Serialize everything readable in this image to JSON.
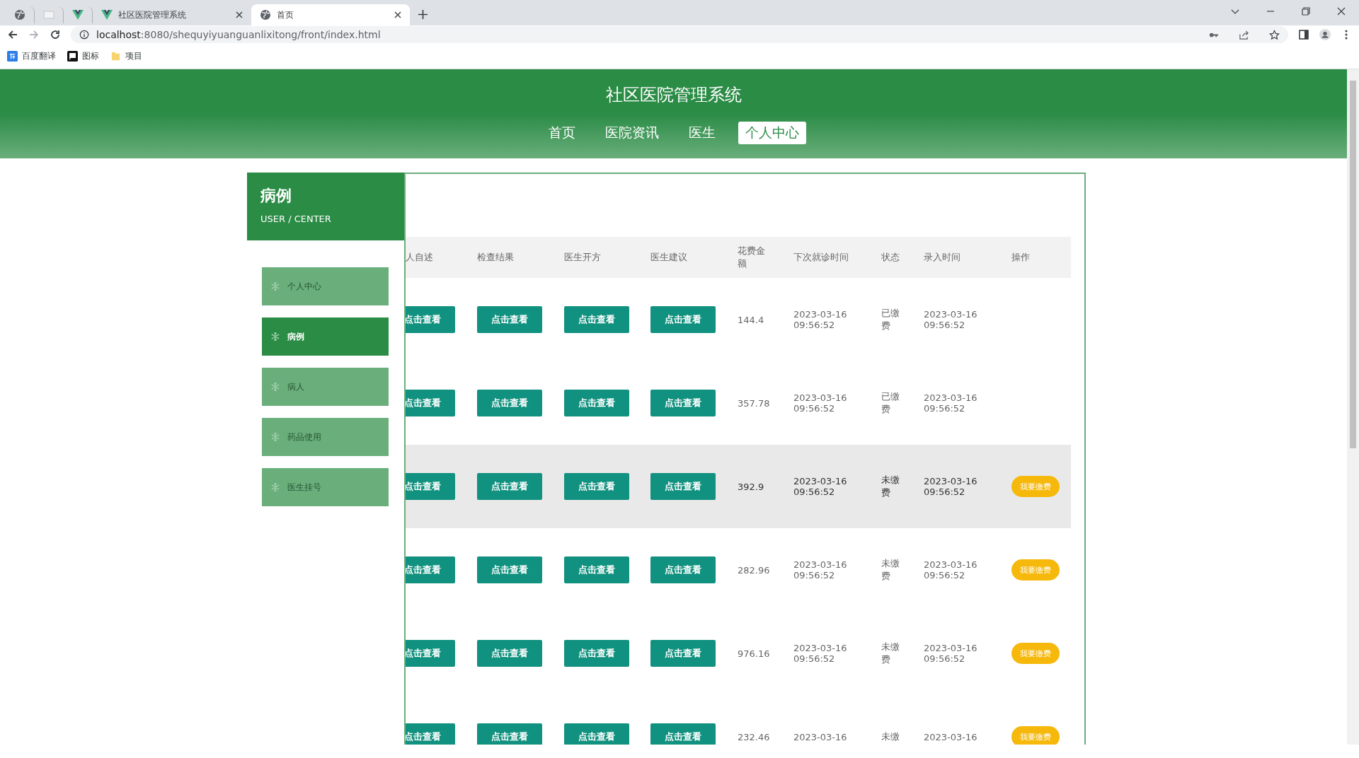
{
  "browser": {
    "tabs": [
      {
        "kind": "globe",
        "selected": false
      },
      {
        "kind": "blank",
        "selected": false
      },
      {
        "kind": "vue",
        "selected": false
      },
      {
        "kind": "vue",
        "title": "社区医院管理系统",
        "selected": false
      },
      {
        "kind": "globe",
        "title": "首页",
        "selected": true
      }
    ],
    "url_host": "localhost",
    "url_rest": ":8080/shequyiyuanguanlixitong/front/index.html",
    "bookmarks": [
      {
        "kind": "translate",
        "label": "百度翻译"
      },
      {
        "kind": "flag",
        "label": "图标"
      },
      {
        "kind": "folder",
        "label": "项目"
      }
    ]
  },
  "site": {
    "title": "社区医院管理系统",
    "nav": [
      {
        "label": "首页",
        "selected": false
      },
      {
        "label": "医院资讯",
        "selected": false
      },
      {
        "label": "医生",
        "selected": false
      },
      {
        "label": "个人中心",
        "selected": true
      }
    ]
  },
  "sidebar": {
    "title": "病例",
    "subtitle": "USER / CENTER",
    "items": [
      {
        "label": "个人中心",
        "selected": false
      },
      {
        "label": "病例",
        "selected": true
      },
      {
        "label": "病人",
        "selected": false
      },
      {
        "label": "药品使用",
        "selected": false
      },
      {
        "label": "医生挂号",
        "selected": false
      }
    ]
  },
  "table": {
    "columns": [
      "人自述",
      "检查结果",
      "医生开方",
      "医生建议",
      "花费金额",
      "下次就诊时间",
      "状态",
      "录入时间",
      "操作"
    ],
    "rows": [
      {
        "views": [
          "点击查看",
          "点击查看",
          "点击查看",
          "点击查看"
        ],
        "amount": "144.4",
        "next_visit": "2023-03-16 09:56:52",
        "status": "已缴费",
        "entered": "2023-03-16 09:56:52",
        "hovered": false
      },
      {
        "views": [
          "点击查看",
          "点击查看",
          "点击查看",
          "点击查看"
        ],
        "amount": "357.78",
        "next_visit": "2023-03-16 09:56:52",
        "status": "已缴费",
        "entered": "2023-03-16 09:56:52",
        "hovered": false
      },
      {
        "views": [
          "点击查看",
          "点击查看",
          "点击查看",
          "点击查看"
        ],
        "amount": "392.9",
        "next_visit": "2023-03-16 09:56:52",
        "status": "未缴费",
        "entered": "2023-03-16 09:56:52",
        "action": "我要缴费",
        "hovered": true
      },
      {
        "views": [
          "点击查看",
          "点击查看",
          "点击查看",
          "点击查看"
        ],
        "amount": "282.96",
        "next_visit": "2023-03-16 09:56:52",
        "status": "未缴费",
        "entered": "2023-03-16 09:56:52",
        "action": "我要缴费",
        "hovered": false
      },
      {
        "views": [
          "点击查看",
          "点击查看",
          "点击查看",
          "点击查看"
        ],
        "amount": "976.16",
        "next_visit": "2023-03-16 09:56:52",
        "status": "未缴费",
        "entered": "2023-03-16 09:56:52",
        "action": "我要缴费",
        "hovered": false
      },
      {
        "views": [
          "点击查看",
          "点击查看",
          "点击查看",
          "点击查看"
        ],
        "amount": "232.46",
        "next_visit": "2023-03-16",
        "status": "未缴",
        "entered": "2023-03-16",
        "action": "我要缴费",
        "hovered": false
      }
    ]
  }
}
